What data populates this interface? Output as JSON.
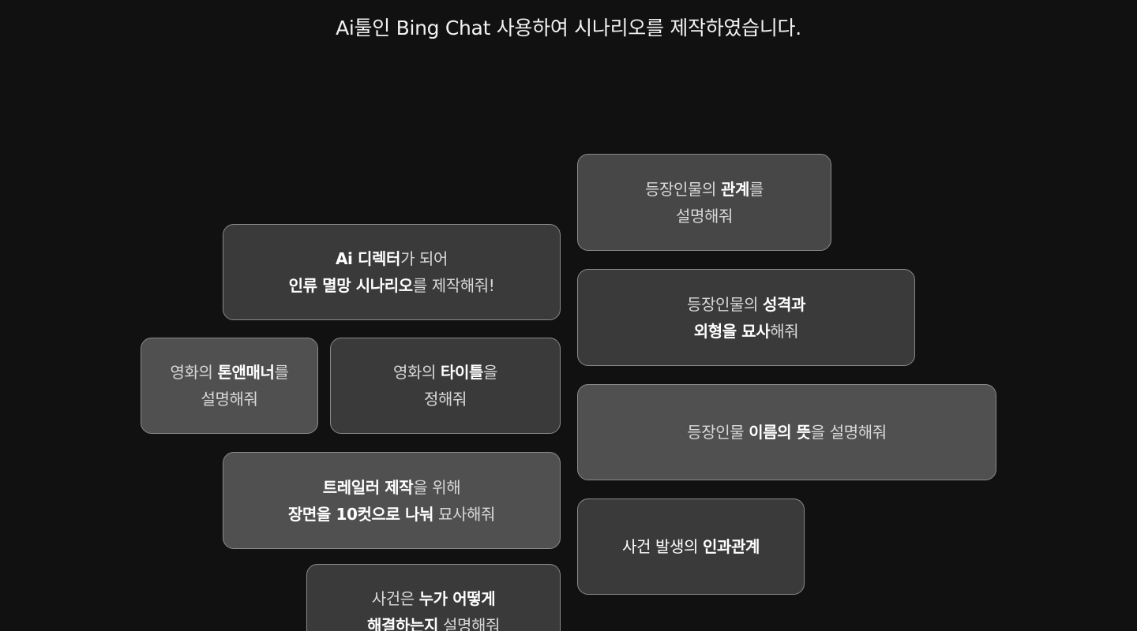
{
  "heading": "Ai툴인 Bing Chat 사용하여 시나리오를 제작하였습니다.",
  "cards": {
    "relationship": {
      "l1a": "등장인물의 ",
      "l1b": "관계",
      "l1c": "를",
      "l2a": "설명해줘"
    },
    "director": {
      "l1a": "Ai 디렉터",
      "l1b": "가 되어",
      "l2a": "인류 멸망 시나리오",
      "l2b": "를 제작해줘!"
    },
    "personality": {
      "l1a": "등장인물의 ",
      "l1b": "성격과",
      "l2a": "외형을 묘사",
      "l2b": "해줘"
    },
    "tone": {
      "l1a": "영화의 ",
      "l1b": "톤앤매너",
      "l1c": "를",
      "l2a": "설명해줘"
    },
    "title": {
      "l1a": "영화의 ",
      "l1b": "타이틀",
      "l1c": "을",
      "l2a": "정해줘"
    },
    "names": {
      "l1a": "등장인물 ",
      "l1b": "이름의 뜻",
      "l1c": "을 설명해줘"
    },
    "trailer": {
      "l1a": "트레일러 제작",
      "l1b": "을 위해",
      "l2a": "장면을 10컷으로 나눠",
      "l2b": " 묘사해줘"
    },
    "causality": {
      "l1a": "사건 발생의 ",
      "l1b": "인과관계"
    },
    "resolve": {
      "l1a": "사건은 ",
      "l1b": "누가 어떻게",
      "l2a": "해결하는지",
      "l2b": " 설명해줘"
    }
  }
}
